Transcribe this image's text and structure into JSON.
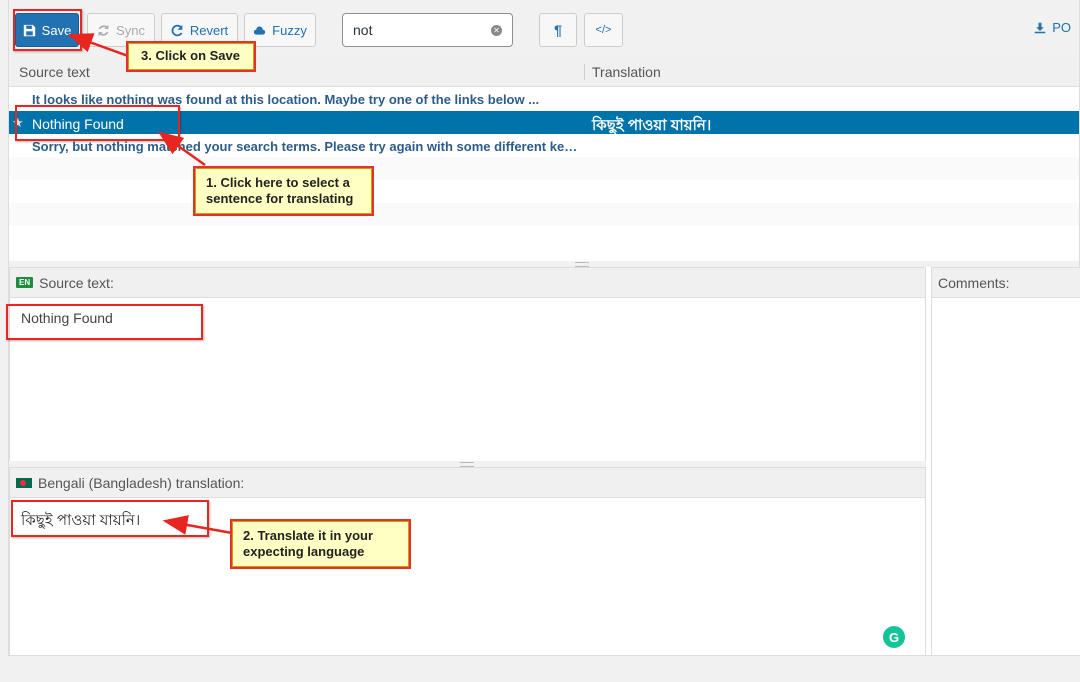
{
  "toolbar": {
    "save_label": "Save",
    "sync_label": "Sync",
    "revert_label": "Revert",
    "fuzzy_label": "Fuzzy",
    "search_value": "not",
    "po_label": "PO"
  },
  "columns": {
    "source": "Source text",
    "translation": "Translation"
  },
  "rows": [
    {
      "source": "It looks like nothing was found at this location. Maybe try one of the links below ...",
      "translation": ""
    },
    {
      "source": "Nothing Found",
      "translation": "কিছুই পাওয়া যায়নি।"
    },
    {
      "source": "Sorry, but nothing matched your search terms. Please try again with some different keywords.",
      "translation": ""
    }
  ],
  "source_pane": {
    "lang_badge": "EN",
    "title": "Source text:",
    "value": "Nothing Found"
  },
  "translation_pane": {
    "title": "Bengali (Bangladesh) translation:",
    "value": "কিছুই পাওয়া যায়নি।"
  },
  "comments_pane": {
    "title": "Comments:"
  },
  "annotations": {
    "step1": "1. Click here to select a sentence for translating",
    "step2": "2. Translate it in your expecting language",
    "step3": "3. Click on Save"
  },
  "colors": {
    "primary": "#2271b1",
    "selected_row": "#0073aa",
    "callout_bg": "#ffffc4",
    "callout_border": "#e53030"
  }
}
